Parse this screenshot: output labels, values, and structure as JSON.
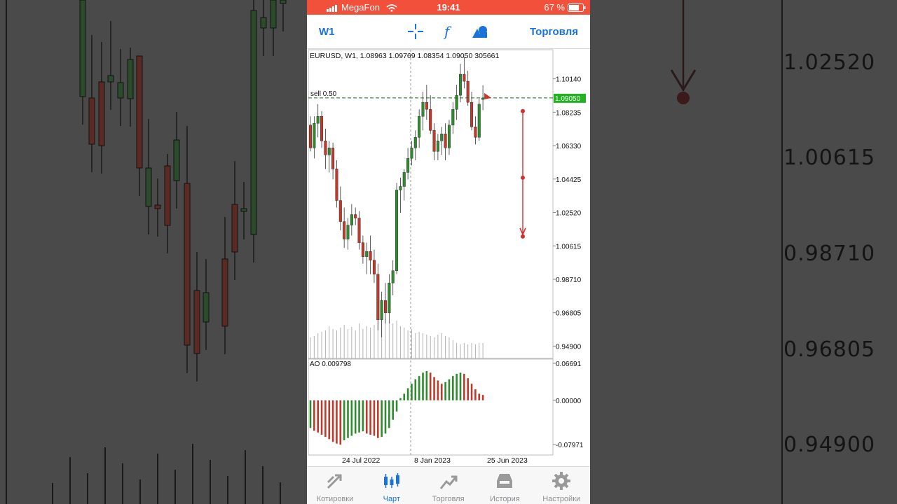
{
  "status_bar": {
    "carrier": "MegaFon",
    "time": "19:41",
    "battery": "67 %"
  },
  "toolbar": {
    "timeframe": "W1",
    "trade_label": "Торговля",
    "icons": [
      "crosshair-icon",
      "function-icon",
      "objects-icon"
    ]
  },
  "chart": {
    "info": "EURUSD, W1, 1.08963 1.09769 1.08354 1.09050 305661",
    "order_label": "sell 0.50",
    "current_price": "1.09050",
    "price_ticks": [
      "1.10140",
      "1.08235",
      "1.06330",
      "1.04425",
      "1.02520",
      "1.00615",
      "0.98710",
      "0.96805",
      "0.94900"
    ],
    "indicator_label": "AO 0.009798",
    "ao_ticks": [
      "0.06691",
      "0.00000",
      "-0.07971"
    ],
    "date_labels": [
      "24 Jul 2022",
      "8 Jan 2023",
      "25 Jun 2023"
    ],
    "colors": {
      "bull": "#2e8b2e",
      "bear": "#c0392b",
      "price_tag": "#21b321",
      "accent": "#1a73d9",
      "status_bar": "#f2503a"
    }
  },
  "chart_data": {
    "type": "candlestick",
    "symbol": "EURUSD",
    "timeframe": "W1",
    "last_bar": {
      "open": 1.08963,
      "high": 1.09769,
      "low": 1.08354,
      "close": 1.0905,
      "volume": 305661
    },
    "ylim": [
      0.942,
      1.118
    ],
    "candles": [
      [
        1.075,
        1.08,
        1.06,
        1.062
      ],
      [
        1.062,
        1.08,
        1.056,
        1.076
      ],
      [
        1.076,
        1.087,
        1.068,
        1.08
      ],
      [
        1.08,
        1.083,
        1.062,
        1.066
      ],
      [
        1.066,
        1.073,
        1.05,
        1.058
      ],
      [
        1.058,
        1.066,
        1.048,
        1.062
      ],
      [
        1.062,
        1.065,
        1.044,
        1.05
      ],
      [
        1.05,
        1.055,
        1.028,
        1.032
      ],
      [
        1.032,
        1.04,
        1.015,
        1.02
      ],
      [
        1.02,
        1.028,
        1.005,
        1.01
      ],
      [
        1.01,
        1.022,
        1.004,
        1.018
      ],
      [
        1.018,
        1.03,
        1.012,
        1.024
      ],
      [
        1.024,
        1.028,
        1.018,
        1.022
      ],
      [
        1.022,
        1.026,
        1.004,
        1.008
      ],
      [
        1.008,
        1.012,
        0.996,
        1.0
      ],
      [
        1.0,
        1.008,
        0.99,
        1.003
      ],
      [
        1.003,
        1.012,
        0.99,
        0.998
      ],
      [
        0.998,
        1.004,
        0.985,
        0.99
      ],
      [
        0.99,
        0.996,
        0.958,
        0.964
      ],
      [
        0.964,
        0.98,
        0.954,
        0.975
      ],
      [
        0.975,
        0.985,
        0.962,
        0.968
      ],
      [
        0.968,
        0.99,
        0.962,
        0.985
      ],
      [
        0.985,
        0.998,
        0.978,
        0.992
      ],
      [
        0.992,
        1.042,
        0.99,
        1.038
      ],
      [
        1.038,
        1.045,
        1.025,
        1.04
      ],
      [
        1.04,
        1.05,
        1.032,
        1.048
      ],
      [
        1.048,
        1.062,
        1.044,
        1.056
      ],
      [
        1.056,
        1.066,
        1.052,
        1.062
      ],
      [
        1.062,
        1.072,
        1.055,
        1.068
      ],
      [
        1.068,
        1.084,
        1.062,
        1.08
      ],
      [
        1.08,
        1.094,
        1.072,
        1.088
      ],
      [
        1.088,
        1.098,
        1.078,
        1.084
      ],
      [
        1.084,
        1.092,
        1.07,
        1.072
      ],
      [
        1.072,
        1.076,
        1.055,
        1.06
      ],
      [
        1.06,
        1.07,
        1.055,
        1.066
      ],
      [
        1.066,
        1.074,
        1.058,
        1.07
      ],
      [
        1.07,
        1.076,
        1.055,
        1.062
      ],
      [
        1.062,
        1.078,
        1.058,
        1.075
      ],
      [
        1.075,
        1.088,
        1.07,
        1.084
      ],
      [
        1.084,
        1.098,
        1.078,
        1.092
      ],
      [
        1.092,
        1.11,
        1.088,
        1.104
      ],
      [
        1.104,
        1.114,
        1.096,
        1.1
      ],
      [
        1.1,
        1.106,
        1.086,
        1.088
      ],
      [
        1.088,
        1.094,
        1.072,
        1.074
      ],
      [
        1.074,
        1.08,
        1.064,
        1.068
      ],
      [
        1.068,
        1.09,
        1.066,
        1.087
      ],
      [
        1.08963,
        1.09769,
        1.08354,
        1.0905
      ]
    ],
    "volume": [
      0.3,
      0.32,
      0.36,
      0.38,
      0.4,
      0.46,
      0.42,
      0.4,
      0.44,
      0.48,
      0.42,
      0.45,
      0.4,
      0.5,
      0.42,
      0.46,
      0.44,
      0.48,
      0.6,
      0.56,
      0.58,
      0.52,
      0.5,
      0.54,
      0.46,
      0.44,
      0.4,
      0.42,
      0.36,
      0.38,
      0.36,
      0.34,
      0.32,
      0.3,
      0.34,
      0.36,
      0.32,
      0.3,
      0.26,
      0.22,
      0.2,
      0.22,
      0.2,
      0.22,
      0.2,
      0.22,
      0.22
    ],
    "ao": [
      -0.05,
      -0.055,
      -0.058,
      -0.062,
      -0.066,
      -0.07,
      -0.075,
      -0.078,
      -0.08,
      -0.072,
      -0.068,
      -0.064,
      -0.06,
      -0.058,
      -0.056,
      -0.06,
      -0.062,
      -0.064,
      -0.068,
      -0.066,
      -0.06,
      -0.05,
      -0.035,
      -0.02,
      0.004,
      0.012,
      0.022,
      0.03,
      0.038,
      0.044,
      0.05,
      0.053,
      0.05,
      0.042,
      0.036,
      0.03,
      0.033,
      0.038,
      0.044,
      0.048,
      0.05,
      0.048,
      0.04,
      0.03,
      0.02,
      0.012,
      0.009798
    ],
    "ao_ylim": [
      -0.07971,
      0.06691
    ],
    "sell_level": 1.0905,
    "projection": {
      "start": 1.083,
      "mid": 1.045,
      "end": 1.0115
    }
  },
  "background": {
    "labels": [
      "1.02520",
      "1.00615",
      "0.98710",
      "0.96805",
      "0.94900"
    ]
  },
  "tabbar": {
    "items": [
      {
        "label": "Котировки",
        "icon": "quotes-icon"
      },
      {
        "label": "Чарт",
        "icon": "chart-icon"
      },
      {
        "label": "Торговля",
        "icon": "trade-icon"
      },
      {
        "label": "История",
        "icon": "history-icon"
      },
      {
        "label": "Настройки",
        "icon": "settings-icon"
      }
    ],
    "active": 1
  }
}
